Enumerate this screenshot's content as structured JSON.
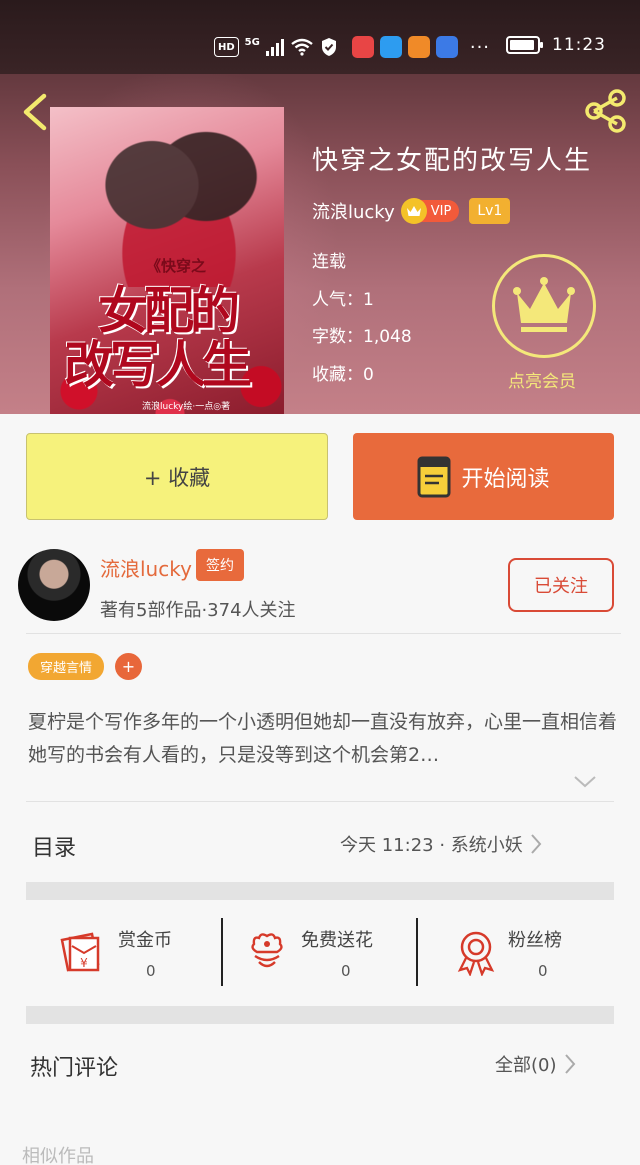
{
  "status_bar": {
    "hd": "HD",
    "network": "5G",
    "time": "11:23",
    "overflow": "···"
  },
  "book": {
    "title": "快穿之女配的改写人生",
    "author": "流浪lucky",
    "vip_label": "VIP",
    "level": "Lv1",
    "status": "连载",
    "popularity": "人气：1",
    "word_count": "字数：1,048",
    "favorites": "收藏：0"
  },
  "cover": {
    "subtitle": "《快穿之",
    "title_line1": "女配的",
    "title_line2": "改写人生",
    "credit": "流浪lucky绘·一点◎著"
  },
  "vip_entry": {
    "label": "点亮会员"
  },
  "actions": {
    "collect": "+ 收藏",
    "read": "开始阅读"
  },
  "author_card": {
    "name": "流浪lucky",
    "signed": "签约",
    "stats": "著有5部作品·374人关注",
    "follow_button": "已关注"
  },
  "tags": {
    "items": [
      "穿越言情"
    ],
    "add": "+"
  },
  "synopsis": "夏柠是个写作多年的一个小透明但她却一直没有放弃，心里一直相信着她写的书会有人看的，只是没等到这个机会第2…",
  "catalog": {
    "title": "目录",
    "update_info": "今天 11:23 · 系统小妖"
  },
  "stats": {
    "reward": {
      "label": "赏金币",
      "value": "0"
    },
    "flowers": {
      "label": "免费送花",
      "value": "0"
    },
    "fans": {
      "label": "粉丝榜",
      "value": "0"
    }
  },
  "comments": {
    "title": "热门评论",
    "all": "全部(0)"
  },
  "similar": {
    "title": "相似作品"
  },
  "colors": {
    "accent": "#e86a3c",
    "collect_bg": "#f6f27c",
    "tag": "#f2a732",
    "vip_gold": "#f4e87a"
  }
}
